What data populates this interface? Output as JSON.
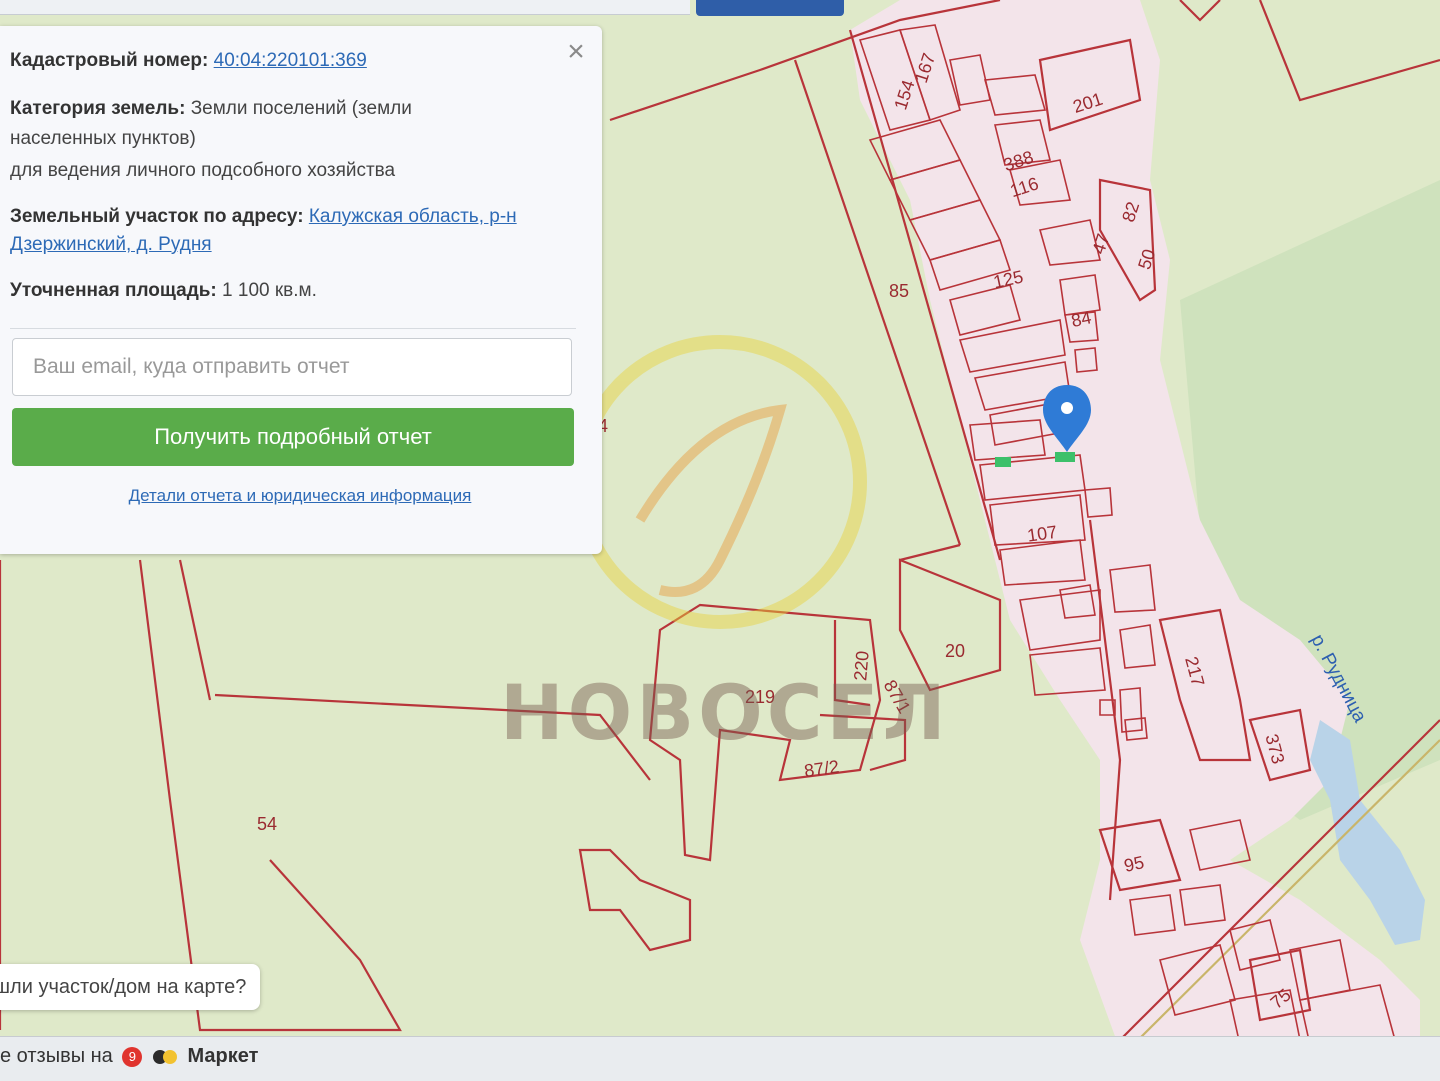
{
  "info_panel": {
    "cadastral_label": "Кадастровый номер:",
    "cadastral_number": "40:04:220101:369",
    "category_label": "Категория земель:",
    "category_value_line1": "Земли поселений (земли",
    "category_value_line2": "населенных пунктов)",
    "category_purpose": "для ведения личного подсобного хозяйства",
    "address_label": "Земельный участок по адресу:",
    "address_line1": "Калужская область, р-н",
    "address_line2": "Дзержинский, д. Рудня",
    "area_label": "Уточненная площадь:",
    "area_value": "1 100 кв.м.",
    "email_placeholder": "Ваш email, куда отправить отчет",
    "report_button": "Получить подробный отчет",
    "details_link": "Детали отчета и юридическая информация",
    "close_icon": "close-icon"
  },
  "map": {
    "parcel_labels": [
      "167",
      "154",
      "201",
      "388",
      "116",
      "82",
      "47",
      "50",
      "125",
      "84",
      "85",
      "4",
      "107",
      "20",
      "220",
      "219",
      "87/1",
      "87/2",
      "217",
      "373",
      "54",
      "95",
      "75"
    ],
    "river_label": "р. Рудница",
    "watermark": "НОВОСЕЛ",
    "marker_icon": "map-pin-icon",
    "colors": {
      "background": "#dfe9c9",
      "settlement": "#f3e4ea",
      "boundary": "#b8343a",
      "water": "#b9d3e8",
      "marker": "#2f7bd6",
      "selected_parcel": "#3cc06a"
    }
  },
  "prompt_bubble": "шли участок/дом на карте?",
  "footer": {
    "text": "е отзывы на",
    "badge": "9",
    "market_label": "Маркет"
  }
}
